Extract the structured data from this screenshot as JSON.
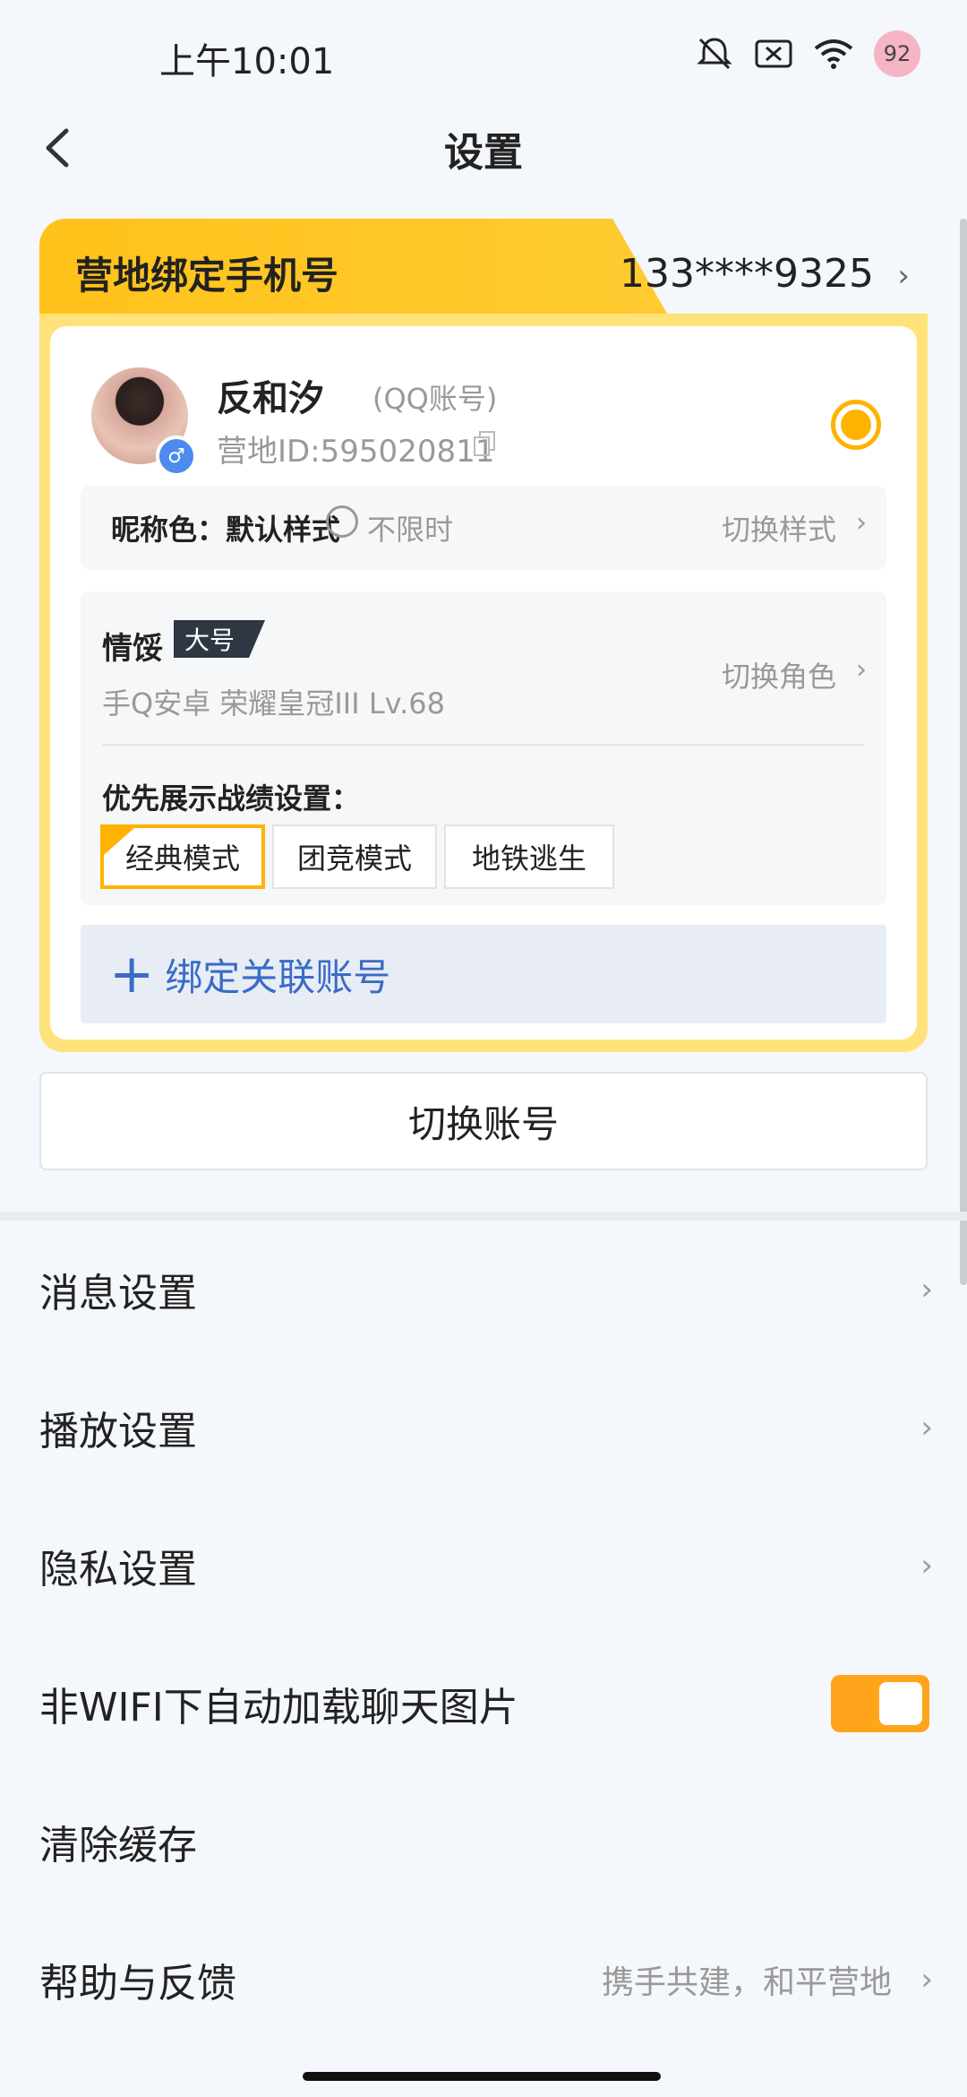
{
  "status_bar": {
    "time": "上午10:01",
    "battery": "92"
  },
  "header": {
    "title": "设置"
  },
  "card": {
    "phone_label": "营地绑定手机号",
    "phone_value": "133****9325",
    "nickname": "反和汐",
    "account_type": "(QQ账号)",
    "camp_id": "营地ID:595020811",
    "name_color_label": "昵称色：默认样式",
    "name_color_time": "不限时",
    "name_color_switch": "切换样式",
    "role_name": "情馁",
    "role_tag": "大号",
    "role_info": "手Q安卓  荣耀皇冠III  Lv.68",
    "role_switch": "切换角色",
    "pref_label": "优先展示战绩设置：",
    "modes": [
      {
        "label": "经典模式",
        "selected": true
      },
      {
        "label": "团竞模式",
        "selected": false
      },
      {
        "label": "地铁逃生",
        "selected": false
      }
    ],
    "bind_label": "绑定关联账号"
  },
  "switch_account": "切换账号",
  "menu": [
    {
      "label": "消息设置"
    },
    {
      "label": "播放设置"
    },
    {
      "label": "隐私设置"
    },
    {
      "label": "非WIFI下自动加载聊天图片",
      "toggle_on": true
    },
    {
      "label": "清除缓存"
    },
    {
      "label": "帮助与反馈",
      "extra": "携手共建，和平营地"
    }
  ],
  "colors": {
    "accent": "#ffb300",
    "link": "#3a6bc7",
    "toggle": "#ffa51c"
  }
}
